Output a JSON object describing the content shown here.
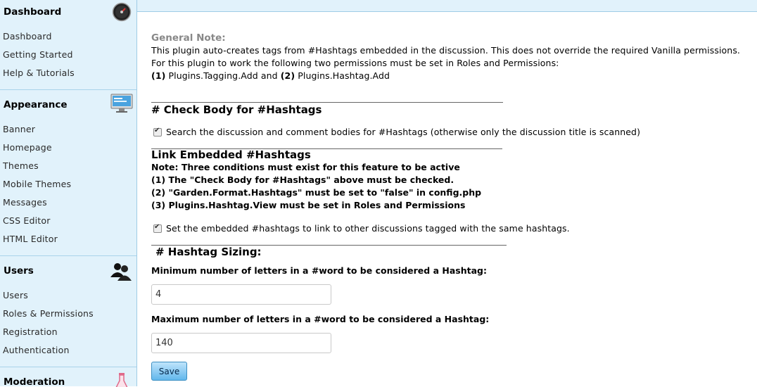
{
  "sidebar": {
    "sections": [
      {
        "title": "Dashboard",
        "icon": "speedometer-icon",
        "items": [
          "Dashboard",
          "Getting Started",
          "Help & Tutorials"
        ]
      },
      {
        "title": "Appearance",
        "icon": "monitor-icon",
        "items": [
          "Banner",
          "Homepage",
          "Themes",
          "Mobile Themes",
          "Messages",
          "CSS Editor",
          "HTML Editor"
        ]
      },
      {
        "title": "Users",
        "icon": "users-icon",
        "items": [
          "Users",
          "Roles & Permissions",
          "Registration",
          "Authentication"
        ]
      },
      {
        "title": "Moderation",
        "icon": "flask-icon",
        "items": []
      }
    ]
  },
  "general_note": {
    "heading": "General Note:",
    "line1": "This plugin auto-creates tags from #Hashtags embedded in the discussion. This does not override the required Vanilla permissions.",
    "line2": "For this plugin to work the following two permissions must be set in Roles and Permissions:",
    "perm1_num": "(1)",
    "perm1_name": "Plugins.Tagging.Add and",
    "perm2_num": "(2)",
    "perm2_name": "Plugins.Hashtag.Add"
  },
  "check_body": {
    "heading": "#  Check Body for #Hashtags",
    "checkbox_label": "Search the discussion and comment bodies for #Hashtags (otherwise only the discussion title is scanned)",
    "checked": true
  },
  "link_embedded": {
    "heading": "Link Embedded #Hashtags",
    "note": "Note: Three conditions must exist for this feature to be active",
    "cond1": "(1) The \"Check Body for #Hashtags\" above must be checked.",
    "cond2": "(2) \"Garden.Format.Hashtags\" must be set to \"false\" in config.php",
    "cond3": "(3) Plugins.Hashtag.View must be set in Roles and Permissions",
    "checkbox_label": "Set the embedded #hashtags to link to other discussions tagged with the same hashtags.",
    "checked": true
  },
  "sizing": {
    "heading": "#  Hashtag Sizing:",
    "min_label": "Minimum number of letters in a #word to be considered a Hashtag:",
    "min_value": "4",
    "max_label": "Maximum number of letters in a #word to be considered a Hashtag:",
    "max_value": "140"
  },
  "save_label": "Save"
}
